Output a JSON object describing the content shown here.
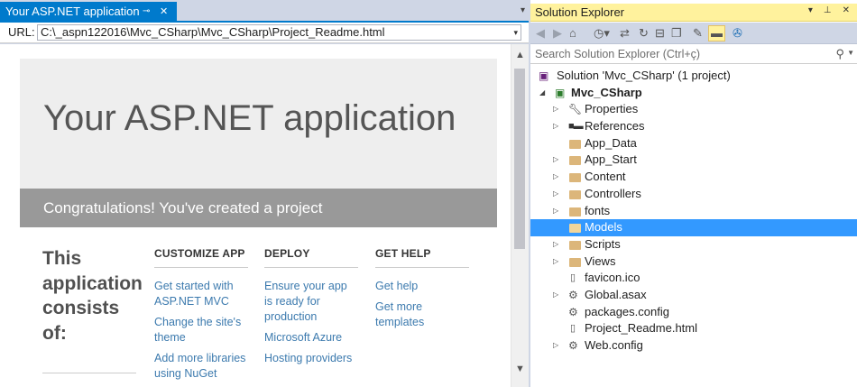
{
  "document": {
    "tab_title": "Your ASP.NET application",
    "pin_glyph": "⊸",
    "close_glyph": "✕",
    "overflow_glyph": "▾",
    "url_label": "URL:",
    "url_value": "C:\\_aspn122016\\Mvc_CSharp\\Mvc_CSharp\\Project_Readme.html",
    "url_dropdown_glyph": "▾"
  },
  "page": {
    "jumbotron_title": "Your ASP.NET application",
    "banner_text": "Congratulations! You've created a project",
    "heading": "This application consists of:",
    "columns": [
      {
        "title": "CUSTOMIZE APP",
        "links": [
          "Get started with ASP.NET MVC",
          "Change the site's theme",
          "Add more libraries using NuGet"
        ]
      },
      {
        "title": "DEPLOY",
        "links": [
          "Ensure your app is ready for production",
          "Microsoft Azure",
          "Hosting providers"
        ]
      },
      {
        "title": "GET HELP",
        "links": [
          "Get help",
          "Get more templates"
        ]
      }
    ]
  },
  "solution_explorer": {
    "title": "Solution Explorer",
    "title_controls": [
      "▾",
      "⊥",
      "✕"
    ],
    "search_placeholder": "Search Solution Explorer (Ctrl+ç)",
    "search_icon": "search-icon",
    "accent_selection": "#3399ff",
    "title_highlight": "#fff29d",
    "tree": [
      {
        "label": "Solution 'Mvc_CSharp' (1 project)",
        "level": 0,
        "expander": "",
        "icon": "solution-icon"
      },
      {
        "label": "Mvc_CSharp",
        "level": 1,
        "expander": "◢",
        "icon": "csharp-project-icon",
        "bold": true
      },
      {
        "label": "Properties",
        "level": 2,
        "expander": "▷",
        "icon": "wrench-icon"
      },
      {
        "label": "References",
        "level": 2,
        "expander": "▷",
        "icon": "references-icon"
      },
      {
        "label": "App_Data",
        "level": 2,
        "expander": "",
        "icon": "folder-icon"
      },
      {
        "label": "App_Start",
        "level": 2,
        "expander": "▷",
        "icon": "folder-icon"
      },
      {
        "label": "Content",
        "level": 2,
        "expander": "▷",
        "icon": "folder-icon"
      },
      {
        "label": "Controllers",
        "level": 2,
        "expander": "▷",
        "icon": "folder-icon"
      },
      {
        "label": "fonts",
        "level": 2,
        "expander": "▷",
        "icon": "folder-icon"
      },
      {
        "label": "Models",
        "level": 2,
        "expander": "",
        "icon": "folder-icon",
        "selected": true
      },
      {
        "label": "Scripts",
        "level": 2,
        "expander": "▷",
        "icon": "folder-icon"
      },
      {
        "label": "Views",
        "level": 2,
        "expander": "▷",
        "icon": "folder-icon"
      },
      {
        "label": "favicon.ico",
        "level": 2,
        "expander": "",
        "icon": "image-file-icon"
      },
      {
        "label": "Global.asax",
        "level": 2,
        "expander": "▷",
        "icon": "asax-file-icon"
      },
      {
        "label": "packages.config",
        "level": 2,
        "expander": "",
        "icon": "config-file-icon"
      },
      {
        "label": "Project_Readme.html",
        "level": 2,
        "expander": "",
        "icon": "html-file-icon"
      },
      {
        "label": "Web.config",
        "level": 2,
        "expander": "▷",
        "icon": "config-file-icon"
      }
    ]
  }
}
